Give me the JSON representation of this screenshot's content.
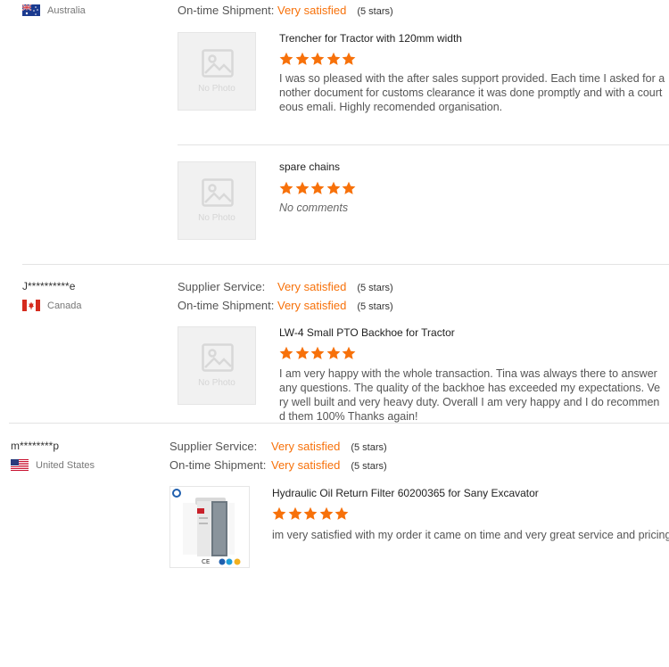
{
  "reviews": [
    {
      "country": "Australia",
      "ratings": [
        {
          "label": "On-time Shipment:",
          "value": "Very satisfied",
          "stars": "(5 stars)"
        }
      ],
      "products": [
        {
          "title": "Trencher for Tractor with 120mm width",
          "image_text": "No Photo",
          "rating": 5,
          "comment": "I was so pleased with the after sales support provided. Each time I asked for another document for customs clearance it was done promptly and with a courteous emali. Highly recomended organisation."
        },
        {
          "title": "spare chains",
          "image_text": "No Photo",
          "rating": 5,
          "comment": "No comments"
        }
      ]
    },
    {
      "buyer": "J**********e",
      "country": "Canada",
      "ratings": [
        {
          "label": "Supplier Service:",
          "value": "Very satisfied",
          "stars": "(5 stars)"
        },
        {
          "label": "On-time Shipment:",
          "value": "Very satisfied",
          "stars": "(5 stars)"
        }
      ],
      "products": [
        {
          "title": "LW-4 Small PTO Backhoe for Tractor",
          "image_text": "No Photo",
          "rating": 5,
          "comment": "I am very happy with the whole transaction. Tina was always there to answer any questions. The quality of the backhoe has exceeded my expectations. Very well built and very heavy duty. Overall I am very happy and I do recommend them 100% Thanks again!"
        }
      ]
    },
    {
      "buyer": "m********p",
      "country": "United States",
      "ratings": [
        {
          "label": "Supplier Service:",
          "value": "Very satisfied",
          "stars": "(5 stars)"
        },
        {
          "label": "On-time Shipment:",
          "value": "Very satisfied",
          "stars": "(5 stars)"
        }
      ],
      "products": [
        {
          "title": "Hydraulic Oil Return Filter 60200365 for Sany Excavator",
          "rating": 5,
          "comment": "im very satisfied with my order it came on time and very great service and pricing"
        }
      ]
    }
  ],
  "colors": {
    "accent": "#f7710a",
    "star": "#f7710a"
  },
  "icons": {
    "star": "star-icon",
    "placeholder": "image-placeholder-icon"
  }
}
